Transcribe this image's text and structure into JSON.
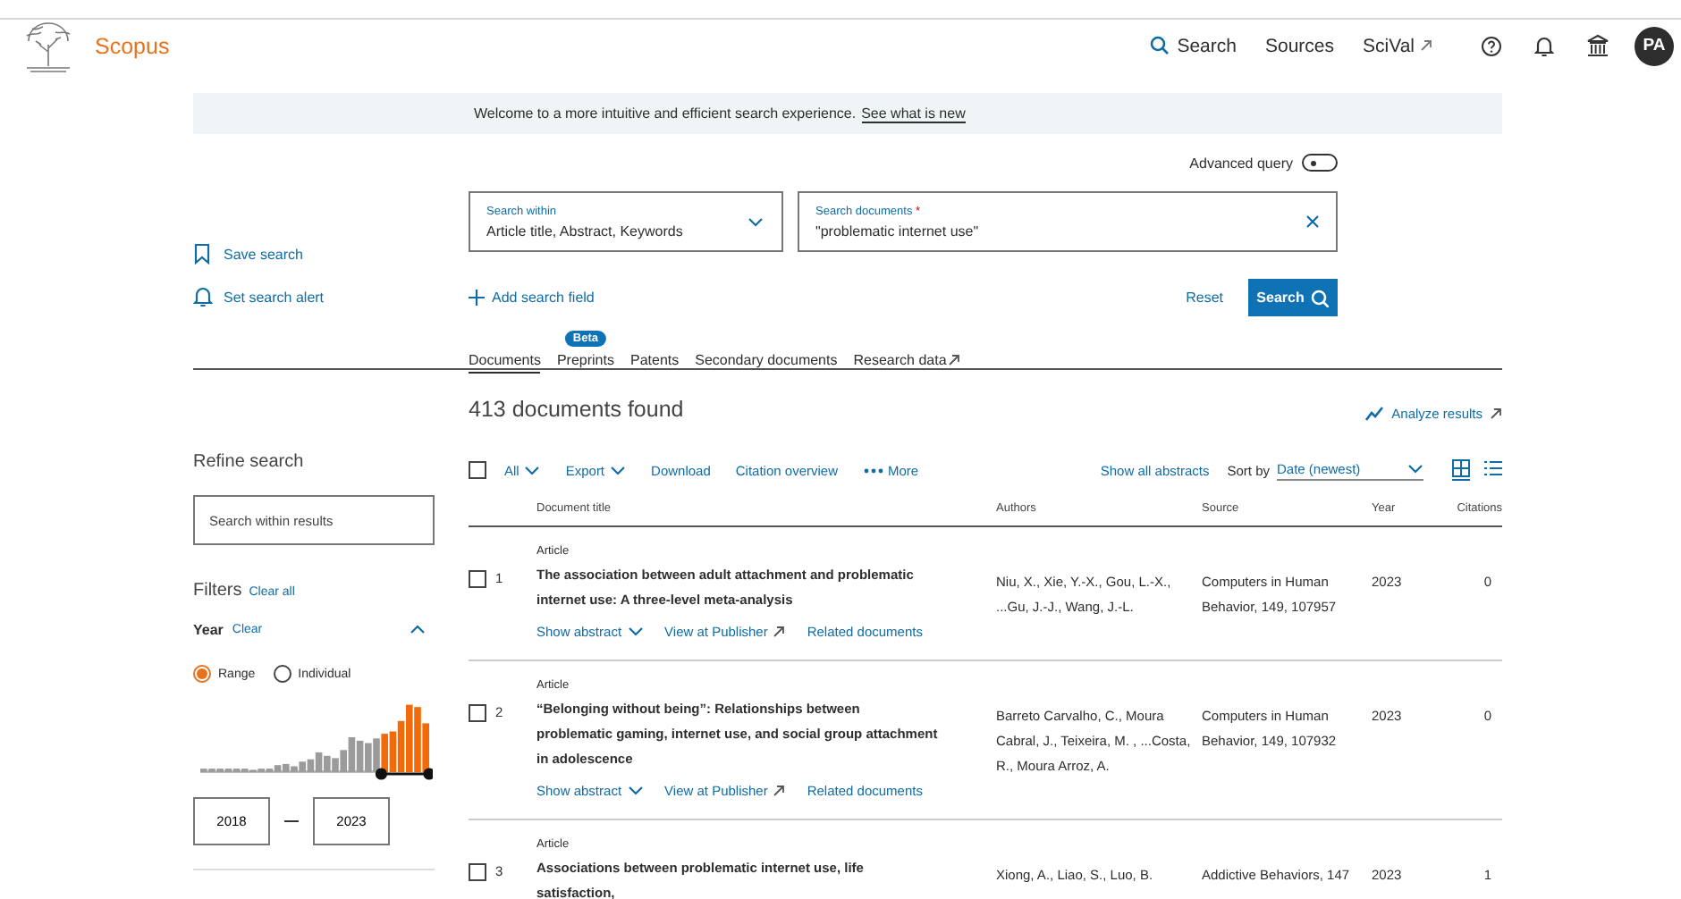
{
  "header": {
    "logo": "Scopus",
    "nav": [
      {
        "label": "Search",
        "kind": "search"
      },
      {
        "label": "Sources",
        "kind": "plain"
      },
      {
        "label": "SciVal",
        "kind": "external"
      }
    ],
    "avatar": "PA"
  },
  "banner": {
    "text": "Welcome to a more intuitive and efficient search experience.",
    "link": "See what is new"
  },
  "advanced_query": {
    "label": "Advanced query",
    "on": false
  },
  "search_within": {
    "label": "Search within",
    "value": "Article title, Abstract, Keywords"
  },
  "search_documents": {
    "label": "Search documents",
    "required_mark": "*",
    "value": "\"problematic internet use\""
  },
  "side_actions": [
    {
      "label": "Save search",
      "kind": "bookmark"
    },
    {
      "label": "Set search alert",
      "kind": "bell"
    }
  ],
  "add_field": "Add search field",
  "reset": "Reset",
  "search_button": "Search",
  "tabs": [
    {
      "label": "Documents",
      "selected": true
    },
    {
      "label": "Preprints",
      "selected": false,
      "badge": "Beta"
    },
    {
      "label": "Patents",
      "selected": false
    },
    {
      "label": "Secondary documents",
      "selected": false
    },
    {
      "label": "Research data",
      "selected": false,
      "external": true
    }
  ],
  "results_count": "413 documents found",
  "analyze": "Analyze results",
  "refine": {
    "title": "Refine search",
    "search_placeholder": "Search within results",
    "filters_title": "Filters",
    "clear_all": "Clear all",
    "year": {
      "title": "Year",
      "clear": "Clear",
      "expanded": true,
      "modes": [
        {
          "label": "Range",
          "selected": true
        },
        {
          "label": "Individual",
          "selected": false
        }
      ],
      "from": "2018",
      "to": "2023"
    }
  },
  "toolbar": {
    "select_all_checked": false,
    "all": "All",
    "export": "Export",
    "download": "Download",
    "citation_overview": "Citation overview",
    "more": "More",
    "show_all_abstracts": "Show all abstracts",
    "sort_label": "Sort by",
    "sort_value": "Date (newest)",
    "views": [
      {
        "kind": "grid",
        "selected": true
      },
      {
        "kind": "list",
        "selected": false
      }
    ]
  },
  "table": {
    "columns": [
      "Document title",
      "Authors",
      "Source",
      "Year",
      "Citations"
    ],
    "rows": [
      {
        "index": "1",
        "checked": false,
        "type": "Article",
        "title": "The association between adult attachment and problematic internet use: A three-level meta-analysis",
        "authors": "Niu, X., Xie, Y.-X., Gou, L.-X., ...Gu, J.-J., Wang, J.-L.",
        "source": "Computers in Human Behavior, 149, 107957",
        "year": "2023",
        "citations": "0",
        "links": [
          {
            "label": "Show abstract",
            "kind": "dropdown"
          },
          {
            "label": "View at Publisher",
            "kind": "external"
          },
          {
            "label": "Related documents",
            "kind": "plain"
          }
        ]
      },
      {
        "index": "2",
        "checked": false,
        "type": "Article",
        "title": "“Belonging without being”: Relationships between problematic gaming, internet use, and social group attachment in adolescence",
        "authors": "Barreto Carvalho, C., Moura Cabral, J., Teixeira, M. , ...Costa, R., Moura Arroz, A.",
        "source": "Computers in Human Behavior, 149, 107932",
        "year": "2023",
        "citations": "0",
        "links": [
          {
            "label": "Show abstract",
            "kind": "dropdown"
          },
          {
            "label": "View at Publisher",
            "kind": "external"
          },
          {
            "label": "Related documents",
            "kind": "plain"
          }
        ]
      },
      {
        "index": "3",
        "checked": false,
        "type": "Article",
        "title": "Associations between problematic internet use, life satisfaction,",
        "authors": "Xiong, A., Liao, S., Luo, B.",
        "source": "Addictive Behaviors, 147",
        "year": "2023",
        "citations": "1",
        "links": []
      }
    ]
  }
}
